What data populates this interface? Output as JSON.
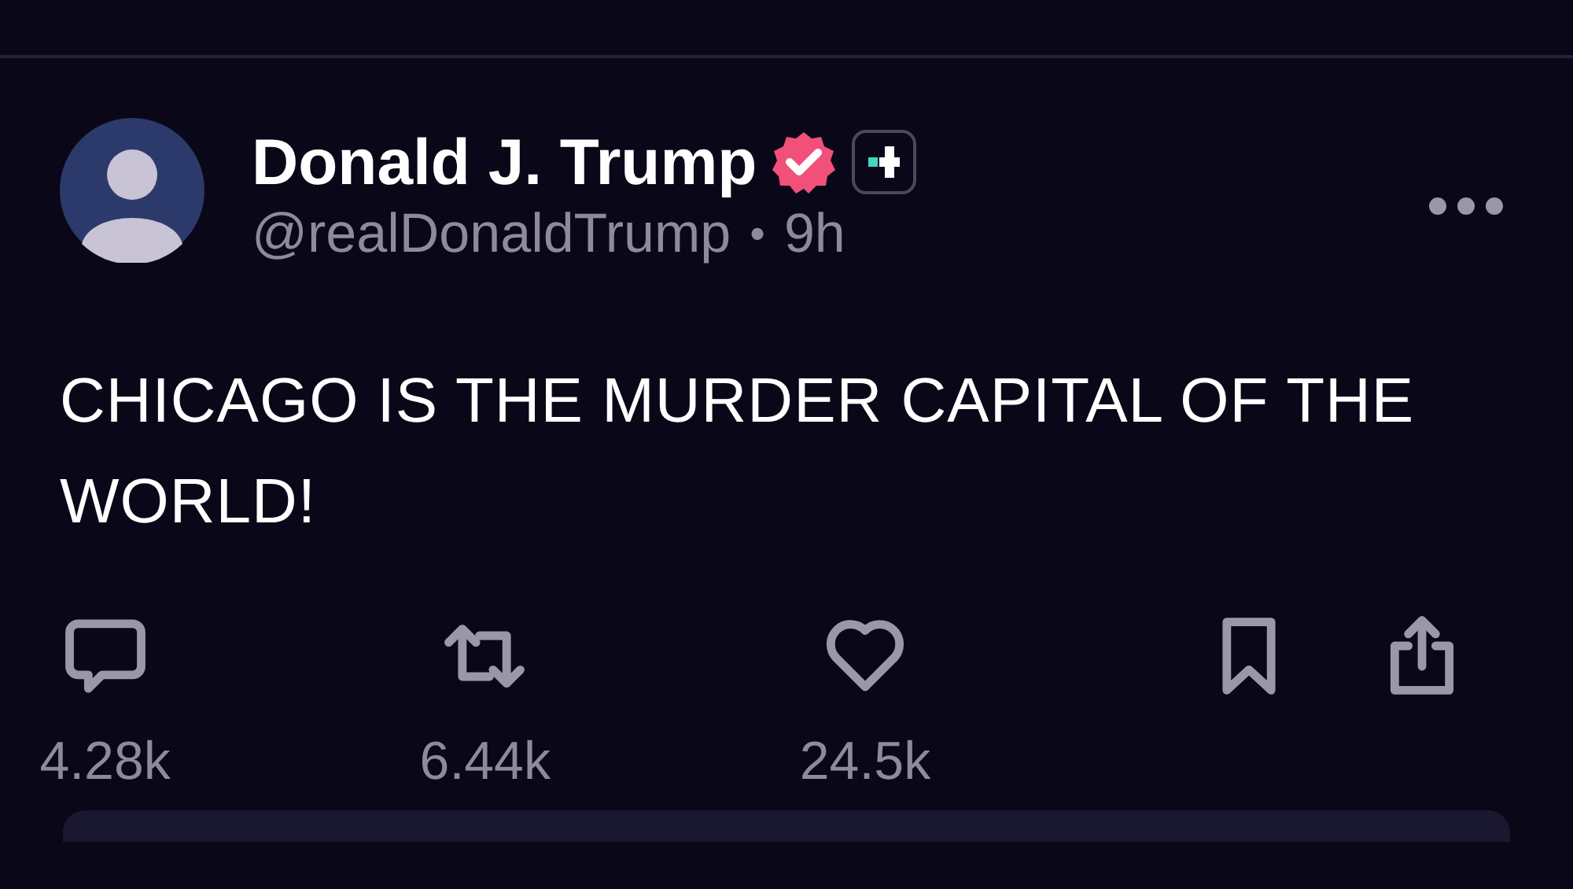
{
  "post": {
    "author": {
      "name": "Donald J. Trump",
      "verified": true,
      "handle": "@realDonaldTrump",
      "separator": "•",
      "time": "9h"
    },
    "text": "CHICAGO IS THE MURDER CAPITAL OF THE WORLD!",
    "actions": [
      {
        "kind": "reply",
        "count": "4.28k"
      },
      {
        "kind": "repost",
        "count": "6.44k"
      },
      {
        "kind": "like",
        "count": "24.5k"
      },
      {
        "kind": "bookmark"
      },
      {
        "kind": "share"
      }
    ]
  }
}
